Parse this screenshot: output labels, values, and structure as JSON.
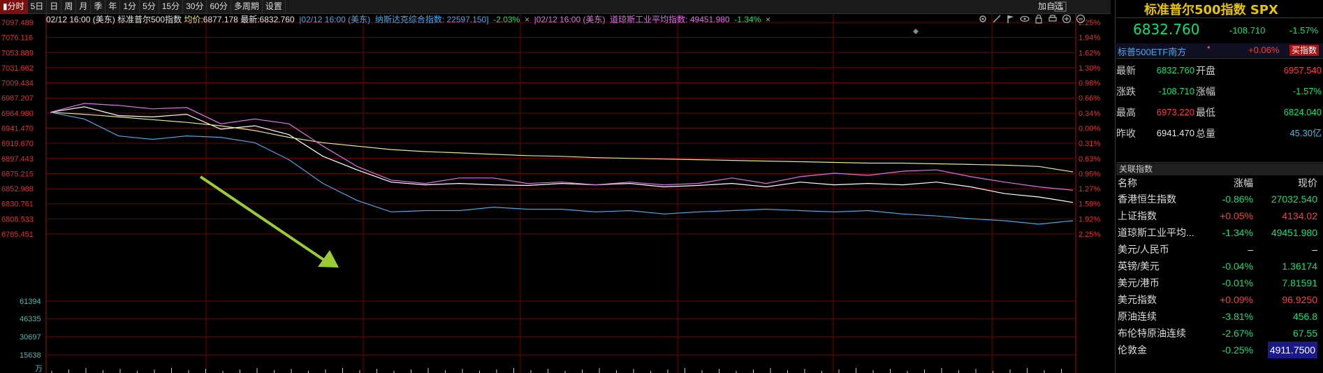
{
  "toolbar": {
    "items": [
      "分时",
      "5日",
      "日",
      "周",
      "月",
      "季",
      "年",
      "1分",
      "5分",
      "15分",
      "30分",
      "60分",
      "多周期",
      "设置"
    ],
    "active_index": 0,
    "add_watch_label": "加自选"
  },
  "info": {
    "time1": "02/12 16:00 (美东)",
    "name1": "标准普尔500指数",
    "avg_label": "均价:",
    "avg_value": "6877.178",
    "latest_label": "最新:",
    "latest_value": "6832.760",
    "time2": "02/12 16:00 (美东)",
    "name2": "纳斯达克综合指数:",
    "value2": "22597.150",
    "chg2": "-2.03%",
    "close_glyph": "×",
    "time3": "02/12 16:00 (美东)",
    "name3": "道琼斯工业平均指数:",
    "value3": "49451.980",
    "chg3": "-1.34%"
  },
  "chart_data": {
    "type": "line",
    "ylim": [
      6785.451,
      7097.489
    ],
    "left_ticks": [
      "7097.489",
      "7076.116",
      "7053.889",
      "7031.662",
      "7009.434",
      "6987.207",
      "6964.980",
      "6941.470",
      "6919.670",
      "6897.443",
      "6875.215",
      "6852.988",
      "6830.761",
      "6808.533",
      "6785.451"
    ],
    "right_ticks": [
      "2.25%",
      "1.94%",
      "1.62%",
      "1.30%",
      "0.98%",
      "0.66%",
      "0.34%",
      "0.00%",
      "0.31%",
      "0.63%",
      "0.95%",
      "1.27%",
      "1.59%",
      "1.92%",
      "2.25%"
    ],
    "volume_ticks": [
      "61394",
      "46335",
      "30697",
      "15638"
    ],
    "volume_unit": "万",
    "series": [
      {
        "name": "标准普尔500指数",
        "color": "#ffffff",
        "values": [
          6965,
          6973,
          6960,
          6958,
          6962,
          6940,
          6945,
          6932,
          6900,
          6880,
          6862,
          6858,
          6860,
          6858,
          6857,
          6860,
          6858,
          6860,
          6855,
          6857,
          6860,
          6855,
          6862,
          6858,
          6860,
          6858,
          6862,
          6855,
          6845,
          6840,
          6832
        ]
      },
      {
        "name": "均价",
        "color": "#e8e880",
        "values": [
          6965,
          6962,
          6958,
          6954,
          6950,
          6945,
          6938,
          6928,
          6920,
          6915,
          6910,
          6907,
          6905,
          6903,
          6901,
          6900,
          6898,
          6897,
          6896,
          6895,
          6894,
          6893,
          6892,
          6891,
          6890,
          6890,
          6889,
          6888,
          6887,
          6885,
          6877
        ]
      },
      {
        "name": "纳斯达克综合指数",
        "color": "#4aa8e8",
        "values": [
          6965,
          6955,
          6930,
          6925,
          6930,
          6928,
          6920,
          6895,
          6860,
          6835,
          6818,
          6820,
          6820,
          6825,
          6822,
          6822,
          6818,
          6820,
          6815,
          6818,
          6820,
          6822,
          6820,
          6818,
          6820,
          6815,
          6812,
          6808,
          6805,
          6800,
          6805
        ]
      },
      {
        "name": "道琼斯工业平均指数",
        "color": "#e070e8",
        "values": [
          6965,
          6978,
          6975,
          6970,
          6972,
          6948,
          6955,
          6948,
          6915,
          6885,
          6865,
          6860,
          6868,
          6868,
          6860,
          6862,
          6858,
          6862,
          6858,
          6860,
          6868,
          6860,
          6870,
          6875,
          6872,
          6878,
          6880,
          6870,
          6862,
          6855,
          6850
        ]
      }
    ]
  },
  "right_panel": {
    "title": "标准普尔500指数 SPX",
    "price": "6832.760",
    "change": "-108.710",
    "change_pct": "-1.57%",
    "etf_name": "标普500ETF南方",
    "etf_dot": "•",
    "etf_chg": "+0.06%",
    "buy_label": "买指数",
    "quote": [
      {
        "l1": "最新",
        "v1": "6832.760",
        "c1": "green",
        "l2": "开盘",
        "v2": "6957.540",
        "c2": "red"
      },
      {
        "l1": "涨跌",
        "v1": "-108.710",
        "c1": "green",
        "l2": "涨幅",
        "v2": "-1.57%",
        "c2": "green"
      },
      {
        "l1": "最高",
        "v1": "6973.220",
        "c1": "red",
        "l2": "最低",
        "v2": "6824.040",
        "c2": "green"
      },
      {
        "l1": "昨收",
        "v1": "6941.470",
        "c1": "white",
        "l2": "总量",
        "v2": "45.30亿",
        "c2": "teal"
      }
    ],
    "related_title": "关联指数",
    "related_headers": {
      "name": "名称",
      "chg": "涨幅",
      "price": "现价"
    },
    "related": [
      {
        "name": "香港恒生指数",
        "chg": "-0.86%",
        "cc": "green",
        "price": "27032.540",
        "pc": "green"
      },
      {
        "name": "上证指数",
        "chg": "+0.05%",
        "cc": "red",
        "price": "4134.02",
        "pc": "red"
      },
      {
        "name": "道琼斯工业平均...",
        "chg": "-1.34%",
        "cc": "green",
        "price": "49451.980",
        "pc": "green"
      },
      {
        "name": "美元/人民币",
        "chg": "–",
        "cc": "white",
        "price": "–",
        "pc": "white"
      },
      {
        "name": "英镑/美元",
        "chg": "-0.04%",
        "cc": "green",
        "price": "1.36174",
        "pc": "green"
      },
      {
        "name": "美元/港币",
        "chg": "-0.01%",
        "cc": "green",
        "price": "7.81591",
        "pc": "green"
      },
      {
        "name": "美元指数",
        "chg": "+0.09%",
        "cc": "red",
        "price": "96.9250",
        "pc": "red"
      },
      {
        "name": "原油连续",
        "chg": "-3.81%",
        "cc": "green",
        "price": "456.8",
        "pc": "green"
      },
      {
        "name": "布伦特原油连续",
        "chg": "-2.67%",
        "cc": "green",
        "price": "67.55",
        "pc": "green"
      },
      {
        "name": "伦敦金",
        "chg": "-0.25%",
        "cc": "green",
        "price": "4911.7500",
        "pc": "highlight"
      }
    ]
  },
  "colors": {
    "grid": "#7a0000",
    "axis_left": "#e03030",
    "axis_right": "#e03030",
    "volume_tick": "#40c0c0",
    "arrow": "#9acd32"
  }
}
